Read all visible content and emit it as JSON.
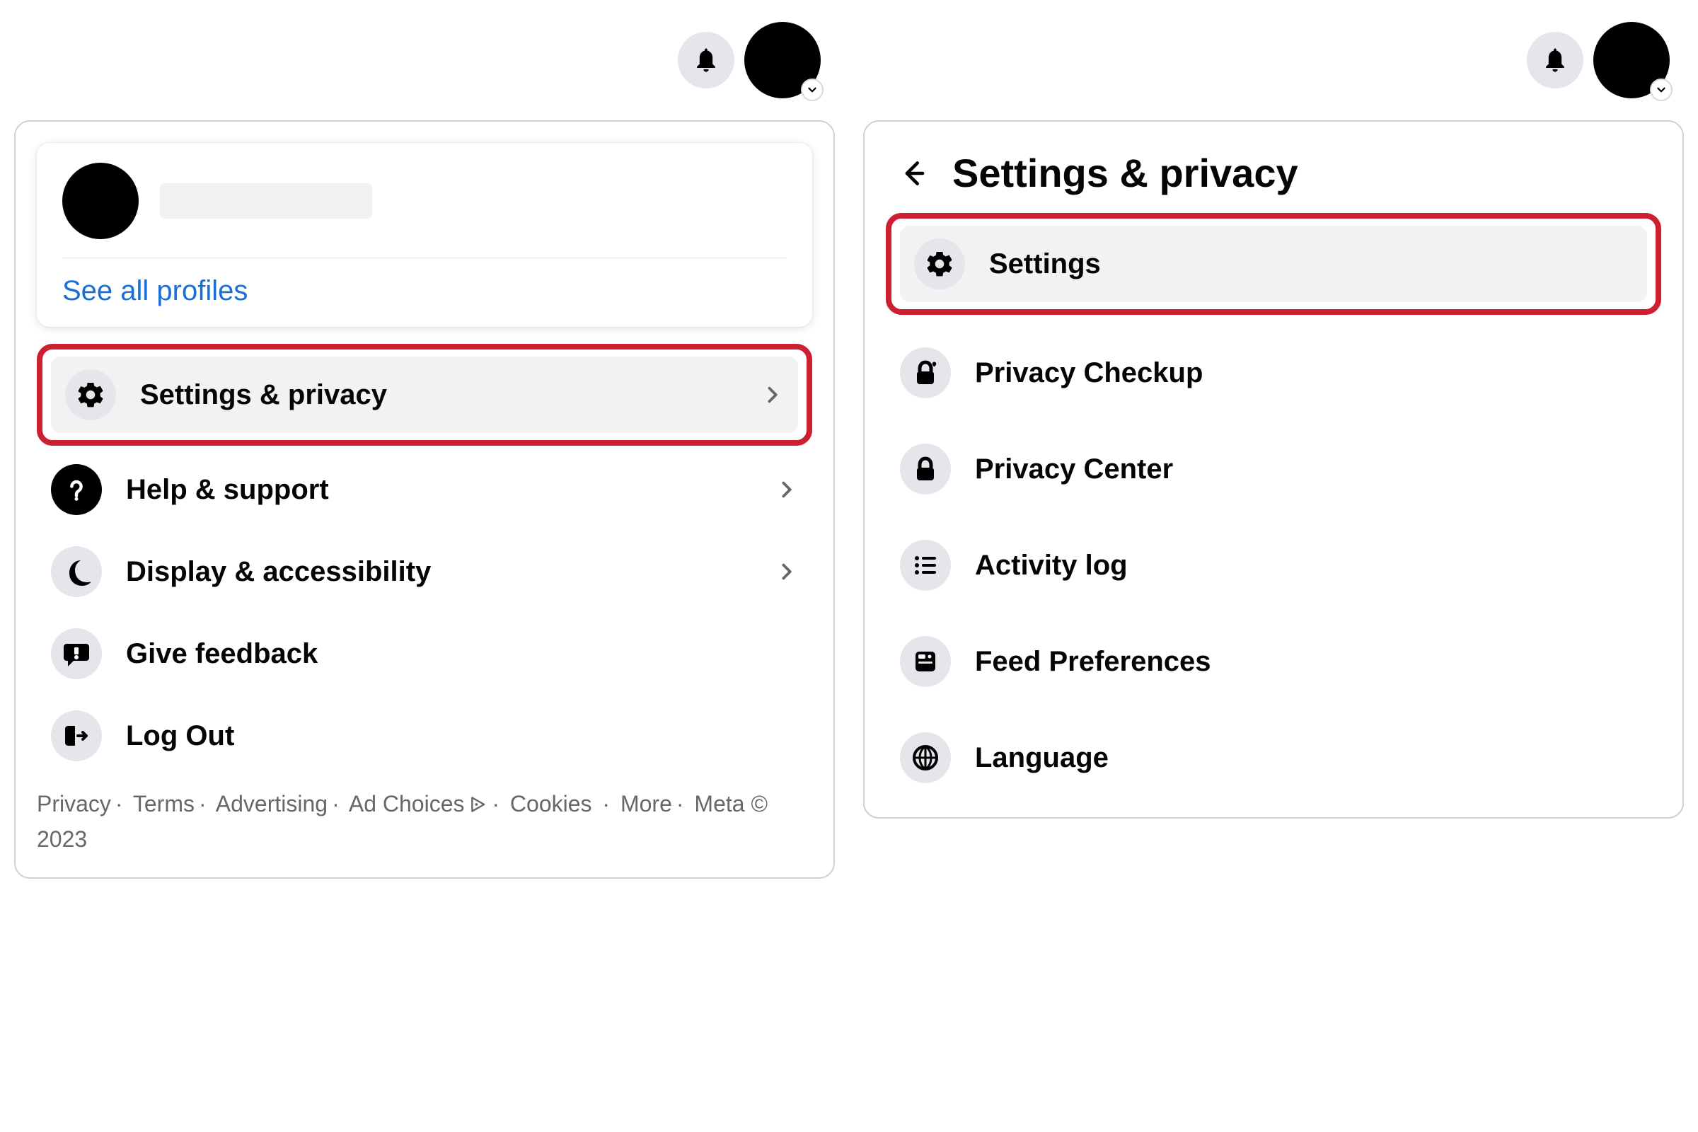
{
  "leftPane": {
    "profile": {
      "see_all_profiles": "See all profiles"
    },
    "menu": [
      {
        "label": "Settings & privacy",
        "icon": "gear",
        "chevron": true,
        "highlighted": true,
        "dark": false
      },
      {
        "label": "Help & support",
        "icon": "question",
        "chevron": true,
        "highlighted": false,
        "dark": true
      },
      {
        "label": "Display & accessibility",
        "icon": "moon",
        "chevron": true,
        "highlighted": false,
        "dark": false
      },
      {
        "label": "Give feedback",
        "icon": "feedback",
        "chevron": false,
        "highlighted": false,
        "dark": false
      },
      {
        "label": "Log Out",
        "icon": "logout",
        "chevron": false,
        "highlighted": false,
        "dark": false
      }
    ],
    "footer": {
      "links": [
        "Privacy",
        "Terms",
        "Advertising",
        "Ad Choices",
        "Cookies",
        "More"
      ],
      "copyright": "Meta © 2023"
    }
  },
  "rightPane": {
    "title": "Settings & privacy",
    "menu": [
      {
        "label": "Settings",
        "icon": "gear",
        "highlighted": true
      },
      {
        "label": "Privacy Checkup",
        "icon": "lock-heart",
        "highlighted": false
      },
      {
        "label": "Privacy Center",
        "icon": "lock",
        "highlighted": false
      },
      {
        "label": "Activity log",
        "icon": "list",
        "highlighted": false
      },
      {
        "label": "Feed Preferences",
        "icon": "feed",
        "highlighted": false
      },
      {
        "label": "Language",
        "icon": "globe",
        "highlighted": false
      }
    ]
  }
}
